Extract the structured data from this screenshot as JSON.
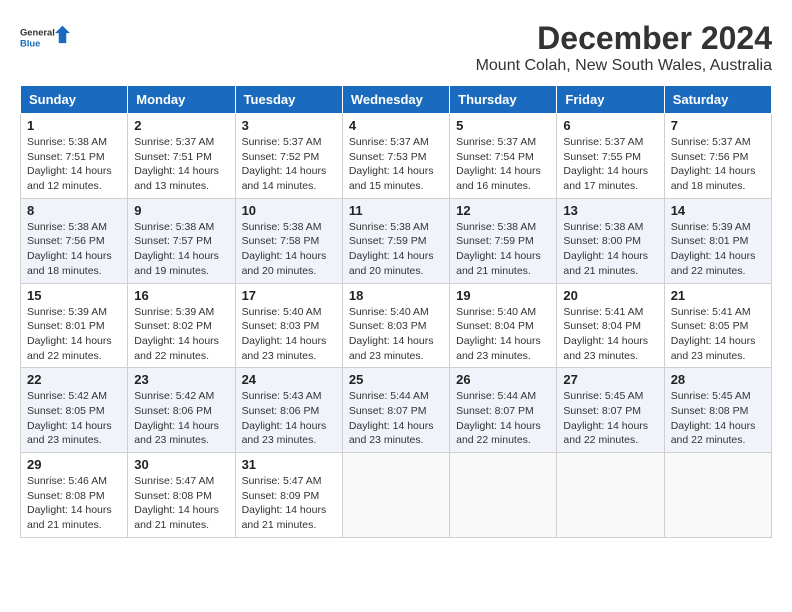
{
  "logo": {
    "line1": "General",
    "line2": "Blue"
  },
  "title": "December 2024",
  "subtitle": "Mount Colah, New South Wales, Australia",
  "weekdays": [
    "Sunday",
    "Monday",
    "Tuesday",
    "Wednesday",
    "Thursday",
    "Friday",
    "Saturday"
  ],
  "weeks": [
    [
      {
        "day": "1",
        "sunrise": "Sunrise: 5:38 AM",
        "sunset": "Sunset: 7:51 PM",
        "daylight": "Daylight: 14 hours",
        "minutes": "and 12 minutes."
      },
      {
        "day": "2",
        "sunrise": "Sunrise: 5:37 AM",
        "sunset": "Sunset: 7:51 PM",
        "daylight": "Daylight: 14 hours",
        "minutes": "and 13 minutes."
      },
      {
        "day": "3",
        "sunrise": "Sunrise: 5:37 AM",
        "sunset": "Sunset: 7:52 PM",
        "daylight": "Daylight: 14 hours",
        "minutes": "and 14 minutes."
      },
      {
        "day": "4",
        "sunrise": "Sunrise: 5:37 AM",
        "sunset": "Sunset: 7:53 PM",
        "daylight": "Daylight: 14 hours",
        "minutes": "and 15 minutes."
      },
      {
        "day": "5",
        "sunrise": "Sunrise: 5:37 AM",
        "sunset": "Sunset: 7:54 PM",
        "daylight": "Daylight: 14 hours",
        "minutes": "and 16 minutes."
      },
      {
        "day": "6",
        "sunrise": "Sunrise: 5:37 AM",
        "sunset": "Sunset: 7:55 PM",
        "daylight": "Daylight: 14 hours",
        "minutes": "and 17 minutes."
      },
      {
        "day": "7",
        "sunrise": "Sunrise: 5:37 AM",
        "sunset": "Sunset: 7:56 PM",
        "daylight": "Daylight: 14 hours",
        "minutes": "and 18 minutes."
      }
    ],
    [
      {
        "day": "8",
        "sunrise": "Sunrise: 5:38 AM",
        "sunset": "Sunset: 7:56 PM",
        "daylight": "Daylight: 14 hours",
        "minutes": "and 18 minutes."
      },
      {
        "day": "9",
        "sunrise": "Sunrise: 5:38 AM",
        "sunset": "Sunset: 7:57 PM",
        "daylight": "Daylight: 14 hours",
        "minutes": "and 19 minutes."
      },
      {
        "day": "10",
        "sunrise": "Sunrise: 5:38 AM",
        "sunset": "Sunset: 7:58 PM",
        "daylight": "Daylight: 14 hours",
        "minutes": "and 20 minutes."
      },
      {
        "day": "11",
        "sunrise": "Sunrise: 5:38 AM",
        "sunset": "Sunset: 7:59 PM",
        "daylight": "Daylight: 14 hours",
        "minutes": "and 20 minutes."
      },
      {
        "day": "12",
        "sunrise": "Sunrise: 5:38 AM",
        "sunset": "Sunset: 7:59 PM",
        "daylight": "Daylight: 14 hours",
        "minutes": "and 21 minutes."
      },
      {
        "day": "13",
        "sunrise": "Sunrise: 5:38 AM",
        "sunset": "Sunset: 8:00 PM",
        "daylight": "Daylight: 14 hours",
        "minutes": "and 21 minutes."
      },
      {
        "day": "14",
        "sunrise": "Sunrise: 5:39 AM",
        "sunset": "Sunset: 8:01 PM",
        "daylight": "Daylight: 14 hours",
        "minutes": "and 22 minutes."
      }
    ],
    [
      {
        "day": "15",
        "sunrise": "Sunrise: 5:39 AM",
        "sunset": "Sunset: 8:01 PM",
        "daylight": "Daylight: 14 hours",
        "minutes": "and 22 minutes."
      },
      {
        "day": "16",
        "sunrise": "Sunrise: 5:39 AM",
        "sunset": "Sunset: 8:02 PM",
        "daylight": "Daylight: 14 hours",
        "minutes": "and 22 minutes."
      },
      {
        "day": "17",
        "sunrise": "Sunrise: 5:40 AM",
        "sunset": "Sunset: 8:03 PM",
        "daylight": "Daylight: 14 hours",
        "minutes": "and 23 minutes."
      },
      {
        "day": "18",
        "sunrise": "Sunrise: 5:40 AM",
        "sunset": "Sunset: 8:03 PM",
        "daylight": "Daylight: 14 hours",
        "minutes": "and 23 minutes."
      },
      {
        "day": "19",
        "sunrise": "Sunrise: 5:40 AM",
        "sunset": "Sunset: 8:04 PM",
        "daylight": "Daylight: 14 hours",
        "minutes": "and 23 minutes."
      },
      {
        "day": "20",
        "sunrise": "Sunrise: 5:41 AM",
        "sunset": "Sunset: 8:04 PM",
        "daylight": "Daylight: 14 hours",
        "minutes": "and 23 minutes."
      },
      {
        "day": "21",
        "sunrise": "Sunrise: 5:41 AM",
        "sunset": "Sunset: 8:05 PM",
        "daylight": "Daylight: 14 hours",
        "minutes": "and 23 minutes."
      }
    ],
    [
      {
        "day": "22",
        "sunrise": "Sunrise: 5:42 AM",
        "sunset": "Sunset: 8:05 PM",
        "daylight": "Daylight: 14 hours",
        "minutes": "and 23 minutes."
      },
      {
        "day": "23",
        "sunrise": "Sunrise: 5:42 AM",
        "sunset": "Sunset: 8:06 PM",
        "daylight": "Daylight: 14 hours",
        "minutes": "and 23 minutes."
      },
      {
        "day": "24",
        "sunrise": "Sunrise: 5:43 AM",
        "sunset": "Sunset: 8:06 PM",
        "daylight": "Daylight: 14 hours",
        "minutes": "and 23 minutes."
      },
      {
        "day": "25",
        "sunrise": "Sunrise: 5:44 AM",
        "sunset": "Sunset: 8:07 PM",
        "daylight": "Daylight: 14 hours",
        "minutes": "and 23 minutes."
      },
      {
        "day": "26",
        "sunrise": "Sunrise: 5:44 AM",
        "sunset": "Sunset: 8:07 PM",
        "daylight": "Daylight: 14 hours",
        "minutes": "and 22 minutes."
      },
      {
        "day": "27",
        "sunrise": "Sunrise: 5:45 AM",
        "sunset": "Sunset: 8:07 PM",
        "daylight": "Daylight: 14 hours",
        "minutes": "and 22 minutes."
      },
      {
        "day": "28",
        "sunrise": "Sunrise: 5:45 AM",
        "sunset": "Sunset: 8:08 PM",
        "daylight": "Daylight: 14 hours",
        "minutes": "and 22 minutes."
      }
    ],
    [
      {
        "day": "29",
        "sunrise": "Sunrise: 5:46 AM",
        "sunset": "Sunset: 8:08 PM",
        "daylight": "Daylight: 14 hours",
        "minutes": "and 21 minutes."
      },
      {
        "day": "30",
        "sunrise": "Sunrise: 5:47 AM",
        "sunset": "Sunset: 8:08 PM",
        "daylight": "Daylight: 14 hours",
        "minutes": "and 21 minutes."
      },
      {
        "day": "31",
        "sunrise": "Sunrise: 5:47 AM",
        "sunset": "Sunset: 8:09 PM",
        "daylight": "Daylight: 14 hours",
        "minutes": "and 21 minutes."
      },
      null,
      null,
      null,
      null
    ]
  ]
}
